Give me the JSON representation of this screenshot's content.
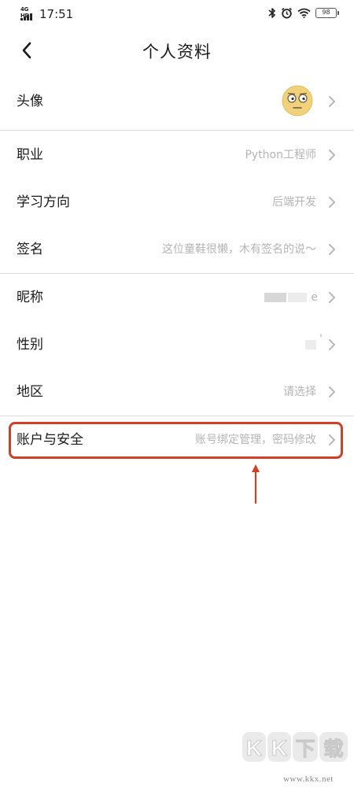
{
  "status_bar": {
    "network": "4G HD",
    "time": "17:51",
    "battery": "98",
    "icons": [
      "bluetooth-icon",
      "alarm-icon",
      "wifi-icon",
      "battery-icon"
    ]
  },
  "header": {
    "title": "个人资料",
    "back_icon": "chevron-left-icon"
  },
  "rows": {
    "avatar": {
      "label": "头像"
    },
    "occupation": {
      "label": "职业",
      "value": "Python工程师"
    },
    "study_direction": {
      "label": "学习方向",
      "value": "后端开发"
    },
    "signature": {
      "label": "签名",
      "value": "这位童鞋很懒，木有签名的说～"
    },
    "nickname": {
      "label": "昵称",
      "value": "e"
    },
    "gender": {
      "label": "性别",
      "value": "'"
    },
    "region": {
      "label": "地区",
      "value": "请选择"
    },
    "account_security": {
      "label": "账户与安全",
      "value": "账号绑定管理，密码修改"
    }
  },
  "annotation": {
    "highlight_color": "#d23f24"
  },
  "watermark": {
    "logo_text": "KK下载",
    "url": "www.kkx.net"
  }
}
